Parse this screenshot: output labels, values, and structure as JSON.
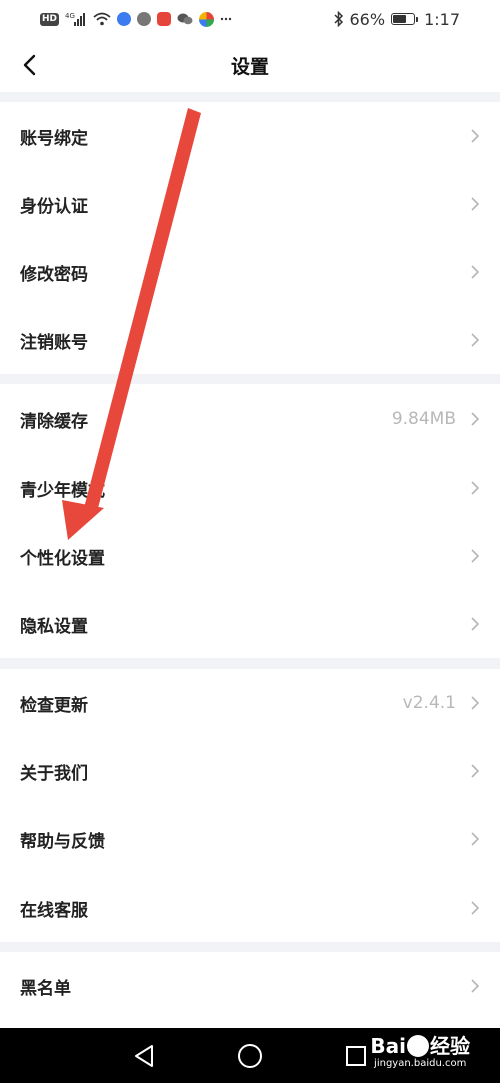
{
  "status_bar": {
    "network_badge": "HD",
    "network_gen": "4G",
    "battery_percent": "66%",
    "battery_level": 0.66,
    "time": "1:17",
    "icons": [
      "hd-icon",
      "signal-icon",
      "wifi-icon",
      "app-icon-blue",
      "app-icon-shield",
      "app-icon-red",
      "wechat-icon",
      "app-icon-colorful",
      "more-dots-icon",
      "bluetooth-icon",
      "battery-icon"
    ]
  },
  "header": {
    "title": "设置",
    "back_icon": "back-chevron-icon"
  },
  "groups": [
    {
      "items": [
        {
          "label": "账号绑定",
          "value": ""
        },
        {
          "label": "身份认证",
          "value": ""
        },
        {
          "label": "修改密码",
          "value": ""
        },
        {
          "label": "注销账号",
          "value": ""
        }
      ]
    },
    {
      "items": [
        {
          "label": "清除缓存",
          "value": "9.84MB"
        },
        {
          "label": "青少年模式",
          "value": ""
        },
        {
          "label": "个性化设置",
          "value": ""
        },
        {
          "label": "隐私设置",
          "value": ""
        }
      ]
    },
    {
      "items": [
        {
          "label": "检查更新",
          "value": "v2.4.1"
        },
        {
          "label": "关于我们",
          "value": ""
        },
        {
          "label": "帮助与反馈",
          "value": ""
        },
        {
          "label": "在线客服",
          "value": ""
        }
      ]
    },
    {
      "items": [
        {
          "label": "黑名单",
          "value": ""
        }
      ]
    }
  ],
  "nav_bar": {
    "buttons": [
      "back-triangle-icon",
      "home-circle-icon",
      "recents-square-icon"
    ]
  },
  "watermark": {
    "brand_left": "Bai",
    "brand_right": "经验",
    "url": "jingyan.baidu.com"
  },
  "colors": {
    "separator": "#f2f3f7",
    "label": "#222222",
    "value": "#b8b8b8",
    "arrow": "#e8473c"
  }
}
